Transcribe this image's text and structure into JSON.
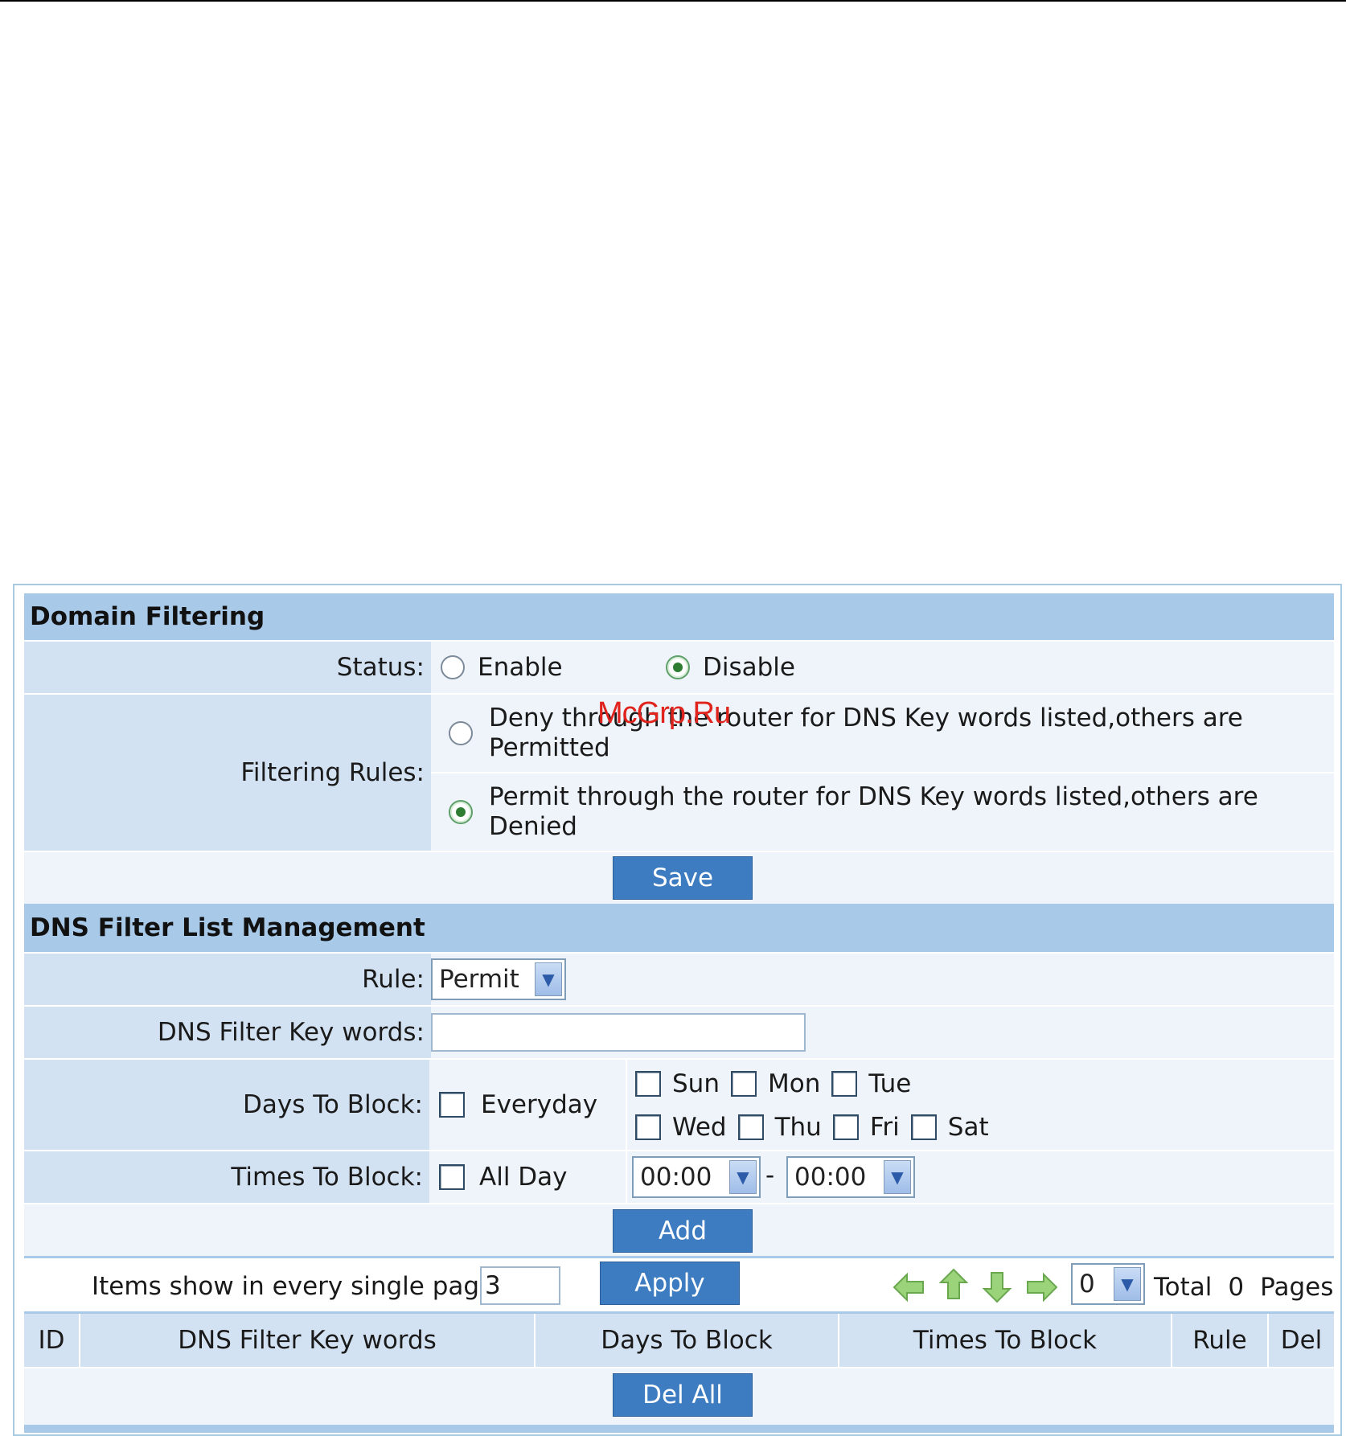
{
  "watermark": "McGrp.Ru",
  "domain_filtering": {
    "title": "Domain Filtering",
    "status_label": "Status:",
    "status_options": [
      "Enable",
      "Disable"
    ],
    "status_selected": "Disable",
    "filtering_rules_label": "Filtering Rules:",
    "rule_deny_line1": "Deny through the router for DNS Key words listed,others are",
    "rule_deny_line2": "Permitted",
    "rule_permit_line1": "Permit through the router for DNS Key words listed,others are",
    "rule_permit_line2": "Denied",
    "rule_selected": "Permit",
    "save_label": "Save"
  },
  "dns_filter": {
    "title": "DNS Filter List Management",
    "rule_label": "Rule:",
    "rule_value": "Permit",
    "keywords_label": "DNS Filter Key words:",
    "keywords_value": "",
    "days_label": "Days To Block:",
    "everyday_label": "Everyday",
    "days": [
      "Sun",
      "Mon",
      "Tue",
      "Wed",
      "Thu",
      "Fri",
      "Sat"
    ],
    "times_label": "Times To Block:",
    "allday_label": "All Day",
    "time_start": "00:00",
    "time_sep": "-",
    "time_end": "00:00",
    "add_label": "Add"
  },
  "list": {
    "items_per_page_label": "Items show in every single page",
    "items_per_page_value": "3",
    "apply_label": "Apply",
    "page_value": "0",
    "total_label": "Total",
    "total_value": "0",
    "pages_label": "Pages",
    "columns": [
      "ID",
      "DNS Filter Key words",
      "Days To Block",
      "Times To Block",
      "Rule",
      "Del"
    ],
    "del_all_label": "Del All"
  },
  "colors": {
    "header_bg": "#a8c9e8",
    "label_bg": "#d3e2f2",
    "value_bg": "#eef4fa",
    "button_bg": "#3d7cc0",
    "nav_arrow": "#8ccb6a"
  }
}
